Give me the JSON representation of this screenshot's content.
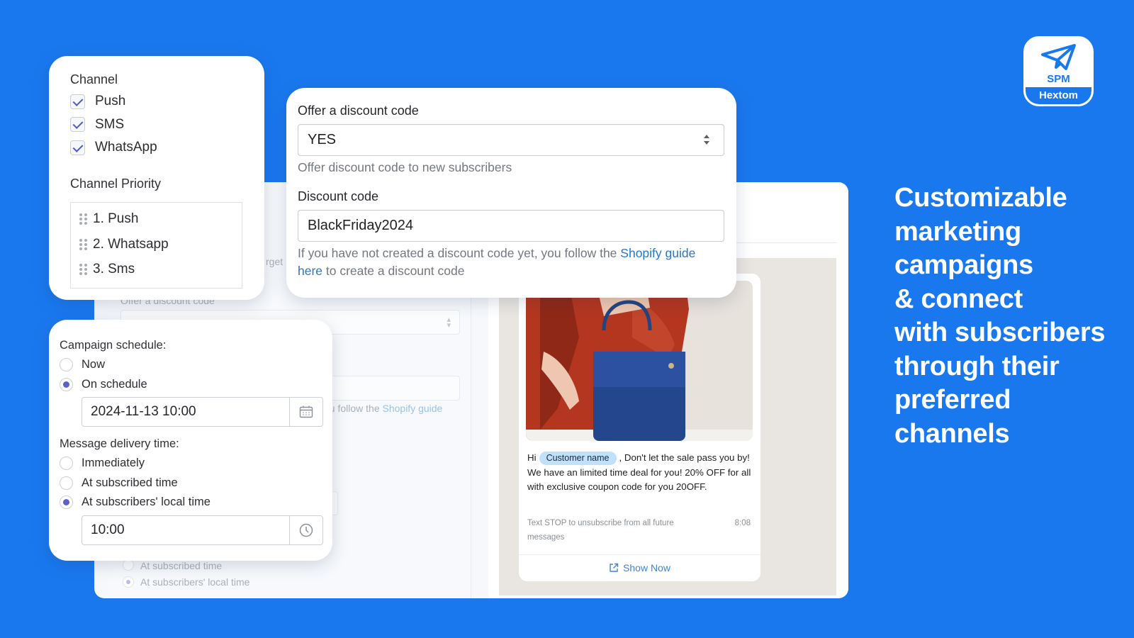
{
  "brand": {
    "logo_top": "SPM",
    "logo_bottom": "Hextom",
    "accent": "#1a78ef"
  },
  "headline": [
    "Customizable",
    "marketing",
    "campaigns",
    "& connect",
    "with subscribers",
    "through their",
    "preferred",
    "channels"
  ],
  "channel_card": {
    "title": "Channel",
    "channels": [
      {
        "label": "Push",
        "checked": true
      },
      {
        "label": "SMS",
        "checked": true
      },
      {
        "label": "WhatsApp",
        "checked": true
      }
    ],
    "priority_title": "Channel Priority",
    "priority": [
      "1. Push",
      "2. Whatsapp",
      "3. Sms"
    ]
  },
  "discount_card": {
    "offer_label": "Offer a discount code",
    "offer_value": "YES",
    "offer_help": "Offer discount code to new subscribers",
    "code_label": "Discount code",
    "code_value": "BlackFriday2024",
    "help_prefix": "If you have not created a discount code yet, you follow the ",
    "help_link1": "Shopify guide",
    "help_link2": "here",
    "help_suffix": " to create a discount code"
  },
  "schedule_card": {
    "schedule_label": "Campaign schedule:",
    "schedule_options": [
      {
        "label": "Now",
        "selected": false
      },
      {
        "label": "On schedule",
        "selected": true
      }
    ],
    "schedule_value": "2024-11-13 10:00",
    "delivery_label": "Message delivery time:",
    "delivery_options": [
      {
        "label": "Immediately",
        "selected": false
      },
      {
        "label": "At subscribed time",
        "selected": false
      },
      {
        "label": "At subscribers' local time",
        "selected": true
      }
    ],
    "delivery_value": "10:00"
  },
  "background_form": {
    "target_fragment": "rget",
    "offer_label": "Offer a discount code",
    "help_fragment": "ou follow the ",
    "help_link": "Shopify guide",
    "radio_immediately": "Immediately",
    "radio_subscribed": "At subscribed time",
    "radio_local": "At subscribers' local time"
  },
  "preview": {
    "greeting": "Hi",
    "customer_chip": "Customer name",
    "message": ", Don't let the sale pass you by! We have an limited time deal for you! 20% OFF for all with exclusive coupon code for you 20OFF.",
    "footer": "Text STOP to unsubscribe from all future messages",
    "time": "8:08",
    "cta": "Show Now"
  }
}
